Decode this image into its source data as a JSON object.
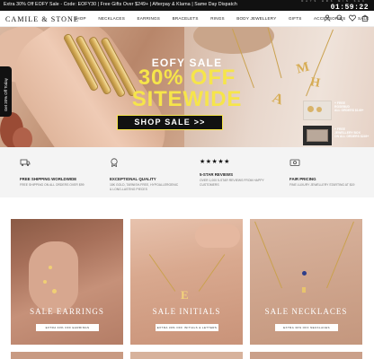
{
  "announcement": {
    "text": "Extra 30% Off EOFY Sale - Code: EOFY30 | Free Gifts Over $249+ | Afterpay & Klarna | Same Day Dispatch",
    "countdown": {
      "labels": "DAYS HRS MIN SEC",
      "digits": "01:59:22"
    }
  },
  "header": {
    "logo": "CAMILE & STONE",
    "nav": [
      "SHOP",
      "NECKLACES",
      "EARRINGS",
      "BRACELETS",
      "RINGS",
      "BODY JEWELLERY",
      "GIFTS",
      "ACCESSORIES",
      "SALE"
    ],
    "icons": [
      "account-icon",
      "search-icon",
      "wishlist-icon",
      "bag-icon"
    ]
  },
  "side_tab": {
    "label": "Get 20% Off Today"
  },
  "hero": {
    "eyebrow": "EOFY SALE",
    "headline_line1": "30% OFF",
    "headline_line2": "SITEWIDE",
    "cta": "SHOP SALE >>",
    "promo1": {
      "line1": "+ FREE",
      "line2": "ROSEBUD",
      "line3": "ALL ORDERS $149+"
    },
    "promo2": {
      "line1": "+ FREE",
      "line2": "JEWELLERY BOX",
      "line3": "ON ALL ORDERS $249+"
    }
  },
  "features": [
    {
      "icon": "truck-icon",
      "title": "FREE SHIPPING WORLDWIDE",
      "sub": "FREE SHIPPING ON ALL ORDERS OVER $99"
    },
    {
      "icon": "badge-icon",
      "title": "EXCEPTIONAL QUALITY",
      "sub": "18K GOLD, TARNISH-FREE, HYPOALLERGENIC & LONG-LASTING PIECES"
    },
    {
      "icon": "stars-icon",
      "title": "5-STAR REVIEWS",
      "sub": "OVER 1,000 5-STAR REVIEWS FROM HAPPY CUSTOMERS",
      "stars": "★★★★★"
    },
    {
      "icon": "card-icon",
      "title": "FAIR PRICING",
      "sub": "FINE LUXURY JEWELLERY STARTING AT $19"
    }
  ],
  "categories": [
    {
      "title": "SALE EARRINGS",
      "cta": "EXTRA 30% OFF EARRINGS"
    },
    {
      "title": "SALE INITIALS",
      "cta": "EXTRA 30% OFF INITIALS & LETTERS"
    },
    {
      "title": "SALE NECKLACES",
      "cta": "EXTRA 30% OFF NECKLACES"
    }
  ],
  "colors": {
    "accent_yellow": "#f6e54a",
    "dark": "#111111",
    "feature_bg": "#f4f4f4"
  }
}
